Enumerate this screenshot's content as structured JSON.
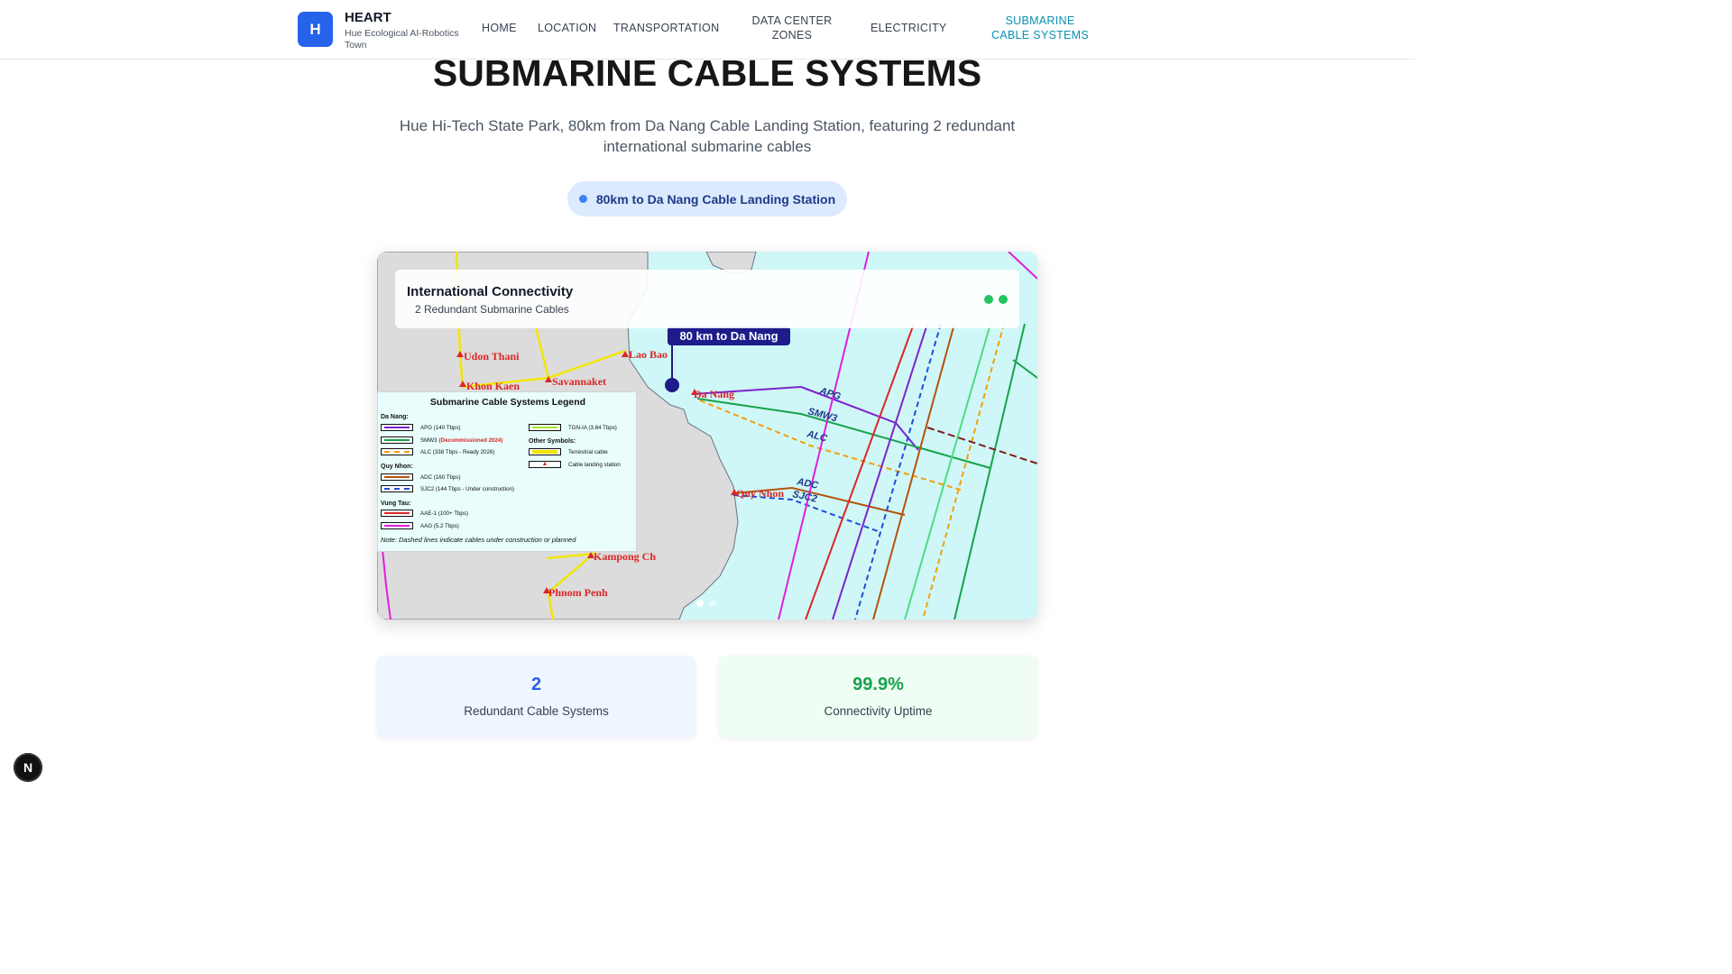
{
  "header": {
    "logo_letter": "H",
    "brand_name": "HEART",
    "brand_sub": "Hue Ecological AI-Robotics Town",
    "nav": [
      {
        "label": "HOME"
      },
      {
        "label": "LOCATION"
      },
      {
        "label": "TRANSPORTATION"
      },
      {
        "label": "DATA CENTER ZONES"
      },
      {
        "label": "ELECTRICITY"
      },
      {
        "label": "SUBMARINE CABLE SYSTEMS"
      }
    ],
    "active_nav": "SUBMARINE CABLE SYSTEMS"
  },
  "hero": {
    "title": "SUBMARINE CABLE SYSTEMS",
    "subtitle": "Hue Hi-Tech State Park, 80km from Da Nang Cable Landing Station, featuring 2 redundant international submarine cables",
    "pill": "80km to Da Nang Cable Landing Station"
  },
  "map": {
    "overlay_title": "International Connectivity",
    "overlay_sub": "2 Redundant Submarine Cables",
    "distance_label": "80 km to Da Nang",
    "cities": {
      "udon_thani": "Udon Thani",
      "lao_bao": "Lao Bao",
      "khon_kaen": "Khon Kaen",
      "savannakhet": "Savannaket",
      "da_nang": "Da Nang",
      "quy_nhon": "Quy Nhon",
      "kampong": "Kampong Ch",
      "phnom_penh": "Phnom Penh"
    },
    "cable_labels": {
      "apg": "APG",
      "smw3": "SMW3",
      "alc": "ALC",
      "adc": "ADC",
      "sjc2": "SJC2"
    },
    "legend": {
      "title": "Submarine Cable Systems Legend",
      "da_nang_head": "Da Nang:",
      "apg": "APG (140 Tbps)",
      "smw3": "SMW3",
      "smw3_note": "(Decommissioned 2024)",
      "alc": "ALC (338 Tbps - Ready 2026)",
      "quy_nhon_head": "Quy Nhon:",
      "adc": "ADC (160 Tbps)",
      "sjc2": "SJC2 (144 Tbps - Under construction)",
      "vung_tau_head": "Vung Tau:",
      "aae1": "AAE-1 (100+ Tbps)",
      "aag": "AAG (5.2 Tbps)",
      "tgn": "TGN-IA (3.84 Tbps)",
      "other_head": "Other Symbols:",
      "terrestrial": "Terrestrial cable",
      "landing": "Cable landing station",
      "note": "Note: Dashed lines indicate cables under construction or planned"
    }
  },
  "stats": [
    {
      "value": "2",
      "label": "Redundant Cable Systems",
      "color": "#2563eb"
    },
    {
      "value": "99.9%",
      "label": "Connectivity Uptime",
      "color": "#16a34a"
    }
  ],
  "dev_badge": "N",
  "colors": {
    "accent": "#2563eb",
    "active_nav": "#0891b2",
    "sea": "#cff7f7",
    "land": "#dcdcdc"
  }
}
